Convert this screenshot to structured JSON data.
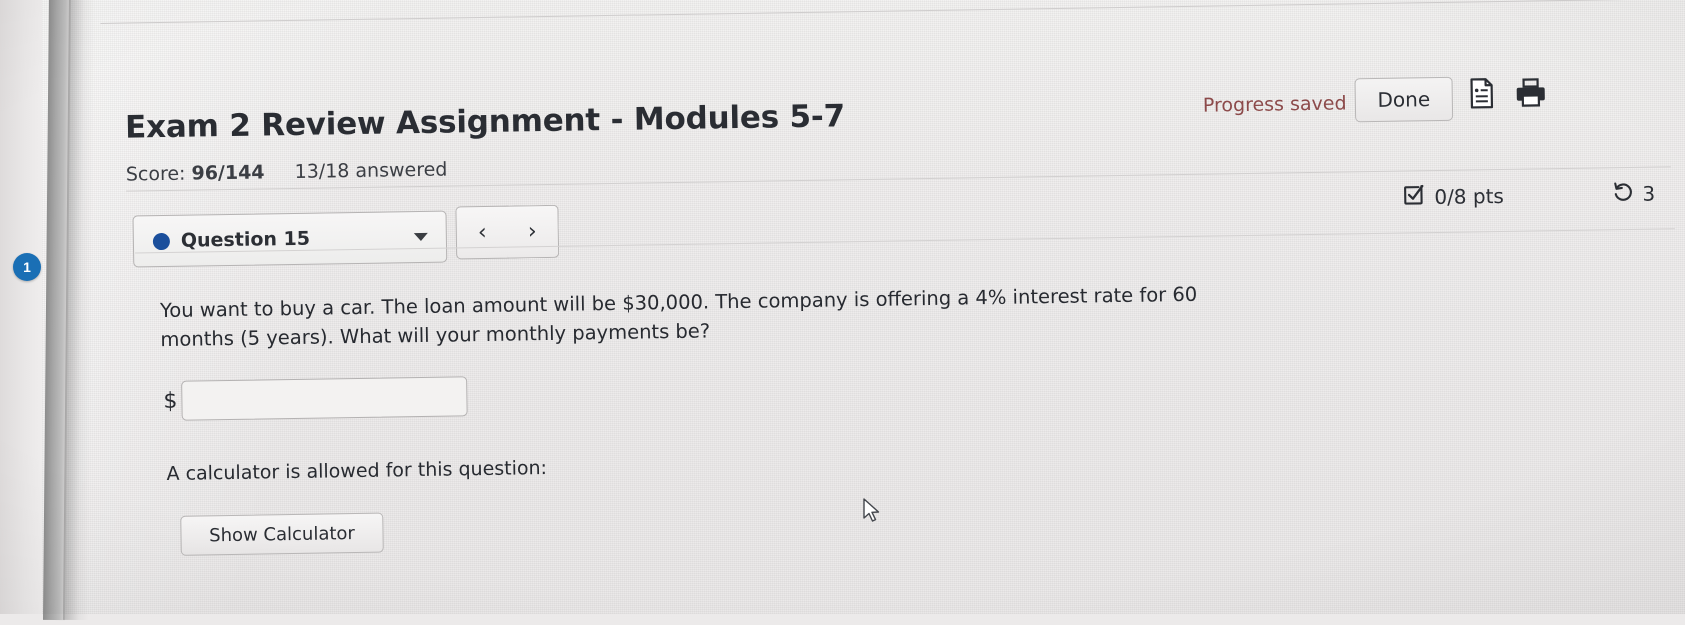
{
  "header": {
    "title": "Exam 2 Review Assignment - Modules 5-7",
    "score_label": "Score:",
    "score_value": "96/144",
    "answered": "13/18 answered",
    "progress_saved": "Progress saved",
    "done_label": "Done",
    "doc_icon": "document-icon",
    "print_icon": "printer-icon"
  },
  "nav": {
    "question_label": "Question 15",
    "status_dot_color": "#1b4f9c",
    "caret_icon": "chevron-down-icon",
    "prev_label": "‹",
    "next_label": "›",
    "points_icon": "checkbox-check-icon",
    "points_text": "0/8 pts",
    "attempts_icon": "retry-circular-arrow-icon",
    "attempts_count": "3"
  },
  "badge": {
    "number": "1"
  },
  "question": {
    "text": "You want to buy a car. The loan amount will be $30,000. The company is offering a 4% interest rate for 60 months (5 years). What will your monthly payments be?",
    "currency_prefix": "$",
    "answer_value": "",
    "answer_placeholder": "",
    "calculator_note": "A calculator is allowed for this question:",
    "show_calculator_label": "Show Calculator"
  },
  "colors": {
    "accent_blue": "#1a6fb5",
    "status_dot": "#1b4f9c",
    "progress_saved": "#8c4a4a",
    "text": "#272a30"
  }
}
